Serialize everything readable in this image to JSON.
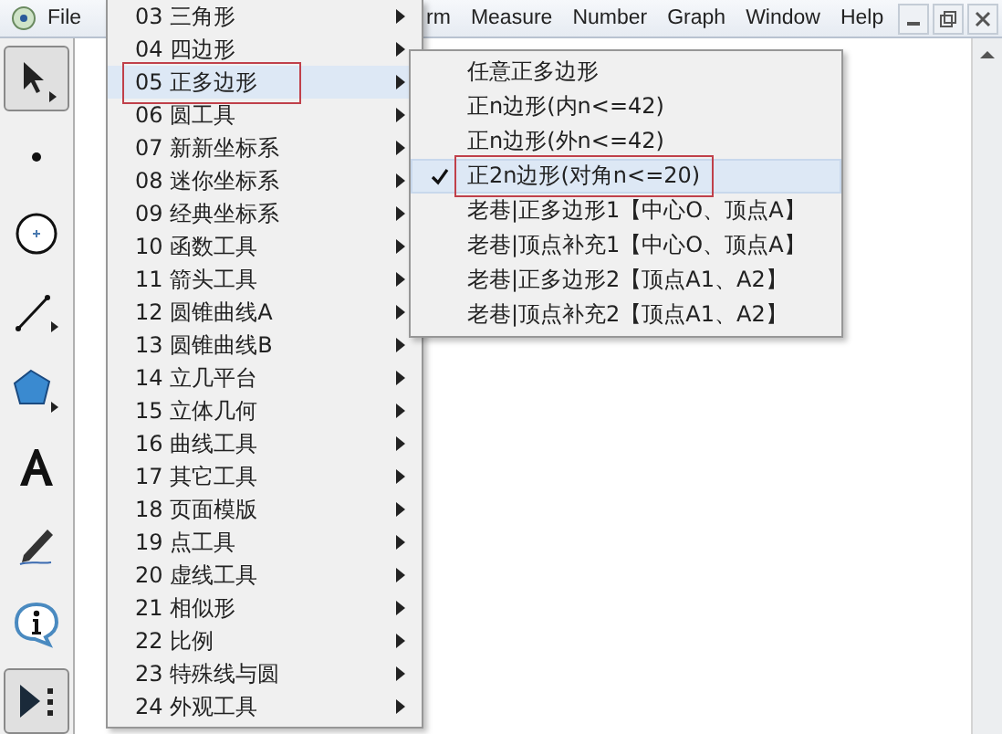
{
  "menubar": [
    {
      "label": "File"
    },
    {
      "label": "rm"
    },
    {
      "label": "Measure"
    },
    {
      "label": "Number"
    },
    {
      "label": "Graph"
    },
    {
      "label": "Window"
    },
    {
      "label": "Help"
    }
  ],
  "tools": [
    {
      "kind": "arrow",
      "selected": true
    },
    {
      "kind": "point",
      "selected": false
    },
    {
      "kind": "compass",
      "selected": false
    },
    {
      "kind": "line",
      "selected": false
    },
    {
      "kind": "polygon",
      "selected": false
    },
    {
      "kind": "text",
      "selected": false
    },
    {
      "kind": "marker",
      "selected": false
    },
    {
      "kind": "info",
      "selected": false
    },
    {
      "kind": "custom",
      "selected": true
    }
  ],
  "custom_tools_menu": {
    "items": [
      {
        "label": "03 三角形",
        "selected": false
      },
      {
        "label": "04 四边形",
        "selected": false
      },
      {
        "label": "05 正多边形",
        "selected": true
      },
      {
        "label": "06 圆工具",
        "selected": false
      },
      {
        "label": "07 新新坐标系",
        "selected": false
      },
      {
        "label": "08 迷你坐标系",
        "selected": false
      },
      {
        "label": "09 经典坐标系",
        "selected": false
      },
      {
        "label": "10 函数工具",
        "selected": false
      },
      {
        "label": "11 箭头工具",
        "selected": false
      },
      {
        "label": "12 圆锥曲线A",
        "selected": false
      },
      {
        "label": "13 圆锥曲线B",
        "selected": false
      },
      {
        "label": "14 立几平台",
        "selected": false
      },
      {
        "label": "15 立体几何",
        "selected": false
      },
      {
        "label": "16 曲线工具",
        "selected": false
      },
      {
        "label": "17 其它工具",
        "selected": false
      },
      {
        "label": "18 页面模版",
        "selected": false
      },
      {
        "label": "19 点工具",
        "selected": false
      },
      {
        "label": "20 虚线工具",
        "selected": false
      },
      {
        "label": "21 相似形",
        "selected": false
      },
      {
        "label": "22 比例",
        "selected": false
      },
      {
        "label": "23 特殊线与圆",
        "selected": false
      },
      {
        "label": "24 外观工具",
        "selected": false
      }
    ]
  },
  "submenu": {
    "items": [
      {
        "label": "任意正多边形",
        "checked": false,
        "selected": false
      },
      {
        "label": "正n边形(内n<=42)",
        "checked": false,
        "selected": false
      },
      {
        "label": "正n边形(外n<=42)",
        "checked": false,
        "selected": false
      },
      {
        "label": "正2n边形(对角n<=20)",
        "checked": true,
        "selected": true
      },
      {
        "label": "老巷|正多边形1【中心O、顶点A】",
        "checked": false,
        "selected": false
      },
      {
        "label": "老巷|顶点补充1【中心O、顶点A】",
        "checked": false,
        "selected": false
      },
      {
        "label": "老巷|正多边形2【顶点A1、A2】",
        "checked": false,
        "selected": false
      },
      {
        "label": "老巷|顶点补充2【顶点A1、A2】",
        "checked": false,
        "selected": false
      }
    ]
  }
}
